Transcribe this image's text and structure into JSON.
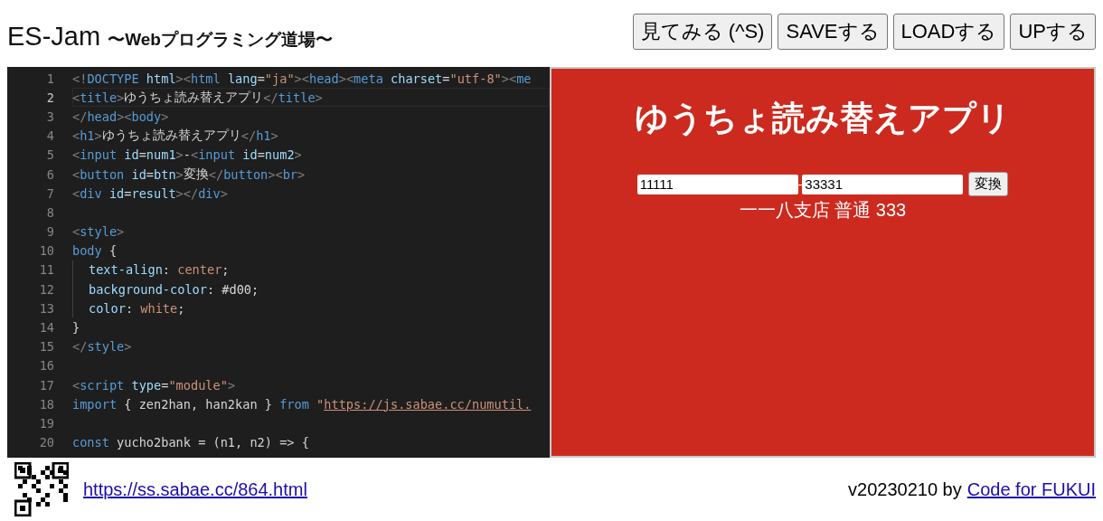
{
  "header": {
    "title": "ES-Jam",
    "subtitle": "〜Webプログラミング道場〜",
    "buttons": [
      "見てみる (^S)",
      "SAVEする",
      "LOADする",
      "UPする"
    ]
  },
  "editor": {
    "lines": [
      {
        "number": "1",
        "current": false,
        "tokens": [
          {
            "kind": "punct",
            "text": "<!"
          },
          {
            "kind": "tag",
            "text": "DOCTYPE"
          },
          {
            "kind": "attr",
            "text": " html"
          },
          {
            "kind": "punct",
            "text": "><"
          },
          {
            "kind": "tag",
            "text": "html"
          },
          {
            "kind": "attr",
            "text": " lang"
          },
          {
            "kind": "plain",
            "text": "="
          },
          {
            "kind": "str",
            "text": "\"ja\""
          },
          {
            "kind": "punct",
            "text": "><"
          },
          {
            "kind": "tag",
            "text": "head"
          },
          {
            "kind": "punct",
            "text": "><"
          },
          {
            "kind": "tag",
            "text": "meta"
          },
          {
            "kind": "attr",
            "text": " charset"
          },
          {
            "kind": "plain",
            "text": "="
          },
          {
            "kind": "str",
            "text": "\"utf-8\""
          },
          {
            "kind": "punct",
            "text": "><"
          },
          {
            "kind": "tag",
            "text": "me"
          }
        ]
      },
      {
        "number": "2",
        "current": true,
        "tokens": [
          {
            "kind": "punct",
            "text": "<"
          },
          {
            "kind": "tag",
            "text": "title"
          },
          {
            "kind": "punct",
            "text": ">"
          },
          {
            "kind": "plain",
            "text": "ゆうちょ読み替えアプリ"
          },
          {
            "kind": "punct",
            "text": "</"
          },
          {
            "kind": "tag",
            "text": "title"
          },
          {
            "kind": "punct",
            "text": ">"
          }
        ]
      },
      {
        "number": "3",
        "current": false,
        "tokens": [
          {
            "kind": "punct",
            "text": "</"
          },
          {
            "kind": "tag",
            "text": "head"
          },
          {
            "kind": "punct",
            "text": "><"
          },
          {
            "kind": "tag",
            "text": "body"
          },
          {
            "kind": "punct",
            "text": ">"
          }
        ]
      },
      {
        "number": "4",
        "current": false,
        "tokens": [
          {
            "kind": "punct",
            "text": "<"
          },
          {
            "kind": "tag",
            "text": "h1"
          },
          {
            "kind": "punct",
            "text": ">"
          },
          {
            "kind": "plain",
            "text": "ゆうちょ読み替えアプリ"
          },
          {
            "kind": "punct",
            "text": "</"
          },
          {
            "kind": "tag",
            "text": "h1"
          },
          {
            "kind": "punct",
            "text": ">"
          }
        ]
      },
      {
        "number": "5",
        "current": false,
        "tokens": [
          {
            "kind": "punct",
            "text": "<"
          },
          {
            "kind": "tag",
            "text": "input"
          },
          {
            "kind": "attr",
            "text": " id"
          },
          {
            "kind": "plain",
            "text": "="
          },
          {
            "kind": "attr",
            "text": "num1"
          },
          {
            "kind": "punct",
            "text": ">"
          },
          {
            "kind": "plain",
            "text": "-"
          },
          {
            "kind": "punct",
            "text": "<"
          },
          {
            "kind": "tag",
            "text": "input"
          },
          {
            "kind": "attr",
            "text": " id"
          },
          {
            "kind": "plain",
            "text": "="
          },
          {
            "kind": "attr",
            "text": "num2"
          },
          {
            "kind": "punct",
            "text": ">"
          }
        ]
      },
      {
        "number": "6",
        "current": false,
        "tokens": [
          {
            "kind": "punct",
            "text": "<"
          },
          {
            "kind": "tag",
            "text": "button"
          },
          {
            "kind": "attr",
            "text": " id"
          },
          {
            "kind": "plain",
            "text": "="
          },
          {
            "kind": "attr",
            "text": "btn"
          },
          {
            "kind": "punct",
            "text": ">"
          },
          {
            "kind": "plain",
            "text": "変換"
          },
          {
            "kind": "punct",
            "text": "</"
          },
          {
            "kind": "tag",
            "text": "button"
          },
          {
            "kind": "punct",
            "text": "><"
          },
          {
            "kind": "tag",
            "text": "br"
          },
          {
            "kind": "punct",
            "text": ">"
          }
        ]
      },
      {
        "number": "7",
        "current": false,
        "tokens": [
          {
            "kind": "punct",
            "text": "<"
          },
          {
            "kind": "tag",
            "text": "div"
          },
          {
            "kind": "attr",
            "text": " id"
          },
          {
            "kind": "plain",
            "text": "="
          },
          {
            "kind": "attr",
            "text": "result"
          },
          {
            "kind": "punct",
            "text": "></"
          },
          {
            "kind": "tag",
            "text": "div"
          },
          {
            "kind": "punct",
            "text": ">"
          }
        ]
      },
      {
        "number": "8",
        "current": false
      },
      {
        "number": "9",
        "current": false,
        "tokens": [
          {
            "kind": "punct",
            "text": "<"
          },
          {
            "kind": "tag",
            "text": "style"
          },
          {
            "kind": "punct",
            "text": ">"
          }
        ]
      },
      {
        "number": "10",
        "current": false,
        "tokens": [
          {
            "kind": "tag",
            "text": "body"
          },
          {
            "kind": "plain",
            "text": " {"
          }
        ]
      },
      {
        "number": "11",
        "current": false,
        "indented": true,
        "tokens": [
          {
            "kind": "attr",
            "text": "text-align"
          },
          {
            "kind": "plain",
            "text": ": "
          },
          {
            "kind": "str",
            "text": "center"
          },
          {
            "kind": "plain",
            "text": ";"
          }
        ]
      },
      {
        "number": "12",
        "current": false,
        "indented": true,
        "tokens": [
          {
            "kind": "attr",
            "text": "background-color"
          },
          {
            "kind": "plain",
            "text": ": #d00;"
          }
        ]
      },
      {
        "number": "13",
        "current": false,
        "indented": true,
        "tokens": [
          {
            "kind": "attr",
            "text": "color"
          },
          {
            "kind": "plain",
            "text": ": "
          },
          {
            "kind": "str",
            "text": "white"
          },
          {
            "kind": "plain",
            "text": ";"
          }
        ]
      },
      {
        "number": "14",
        "current": false,
        "tokens": [
          {
            "kind": "plain",
            "text": "}"
          }
        ]
      },
      {
        "number": "15",
        "current": false,
        "tokens": [
          {
            "kind": "punct",
            "text": "</"
          },
          {
            "kind": "tag",
            "text": "style"
          },
          {
            "kind": "punct",
            "text": ">"
          }
        ]
      },
      {
        "number": "16",
        "current": false
      },
      {
        "number": "17",
        "current": false,
        "tokens": [
          {
            "kind": "punct",
            "text": "<"
          },
          {
            "kind": "tag",
            "text": "script"
          },
          {
            "kind": "attr",
            "text": " type"
          },
          {
            "kind": "plain",
            "text": "="
          },
          {
            "kind": "str",
            "text": "\"module\""
          },
          {
            "kind": "punct",
            "text": ">"
          }
        ]
      },
      {
        "number": "18",
        "current": false,
        "tokens": [
          {
            "kind": "tag",
            "text": "import"
          },
          {
            "kind": "plain",
            "text": " { zen2han, han2kan } "
          },
          {
            "kind": "tag",
            "text": "from"
          },
          {
            "kind": "str",
            "text": " \""
          },
          {
            "kind": "link",
            "text": "https://js.sabae.cc/numutil."
          }
        ]
      },
      {
        "number": "19",
        "current": false
      },
      {
        "number": "20",
        "current": false,
        "tokens": [
          {
            "kind": "tag",
            "text": "const"
          },
          {
            "kind": "plain",
            "text": " yucho2bank = (n1, n2) => {"
          }
        ]
      }
    ]
  },
  "preview": {
    "heading": "ゆうちょ読み替えアプリ",
    "input_1": "11111",
    "separator": "-",
    "input_2": "33331",
    "button": "変換",
    "result": "一一八支店 普通 333"
  },
  "footer": {
    "url": "https://ss.sabae.cc/864.html",
    "version": "v20230210 by",
    "credit": "Code for FUKUI"
  }
}
